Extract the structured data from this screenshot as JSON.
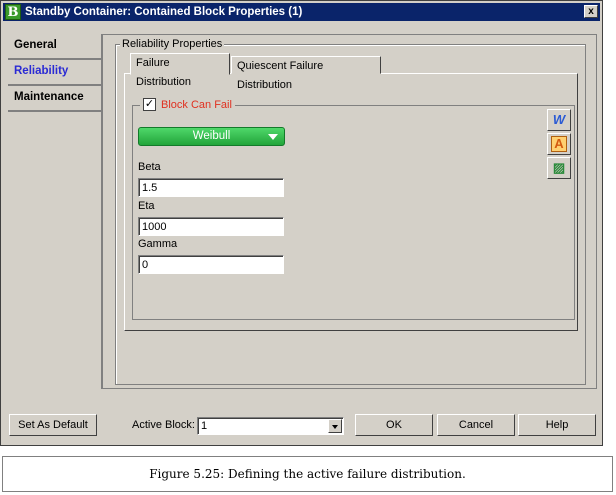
{
  "window": {
    "title": "Standby Container: Contained Block Properties (1)",
    "app_icon": "B",
    "close_glyph": "x"
  },
  "nav": {
    "items": [
      {
        "label": "General"
      },
      {
        "label": "Reliability"
      },
      {
        "label": "Maintenance"
      }
    ],
    "active": "Reliability"
  },
  "reliability": {
    "group_label": "Reliability Properties",
    "tabs": [
      {
        "label": "Failure Distribution"
      },
      {
        "label": "Quiescent Failure Distribution"
      }
    ],
    "block_can_fail": {
      "label": "Block Can Fail",
      "checked": true,
      "glyph": "✓"
    },
    "distribution": {
      "selected": "Weibull"
    },
    "fields": [
      {
        "label": "Beta",
        "value": "1.5"
      },
      {
        "label": "Eta",
        "value": "1000"
      },
      {
        "label": "Gamma",
        "value": "0"
      }
    ],
    "side_buttons": [
      {
        "icon": "weibull-icon",
        "glyph": "W"
      },
      {
        "icon": "wizard-icon",
        "glyph": "A"
      },
      {
        "icon": "plot-icon",
        "glyph": "▨"
      }
    ]
  },
  "footer": {
    "set_default": "Set As Default",
    "active_block_label": "Active Block:",
    "active_block_value": "1",
    "ok": "OK",
    "cancel": "Cancel",
    "help": "Help"
  },
  "caption": "Figure 5.25: Defining the active failure distribution.",
  "colors": {
    "title_bar": "#0a246a",
    "accent_blue": "#2a2ad4",
    "checkbox_label": "#e03020",
    "dropdown_green": "#22a43a"
  }
}
